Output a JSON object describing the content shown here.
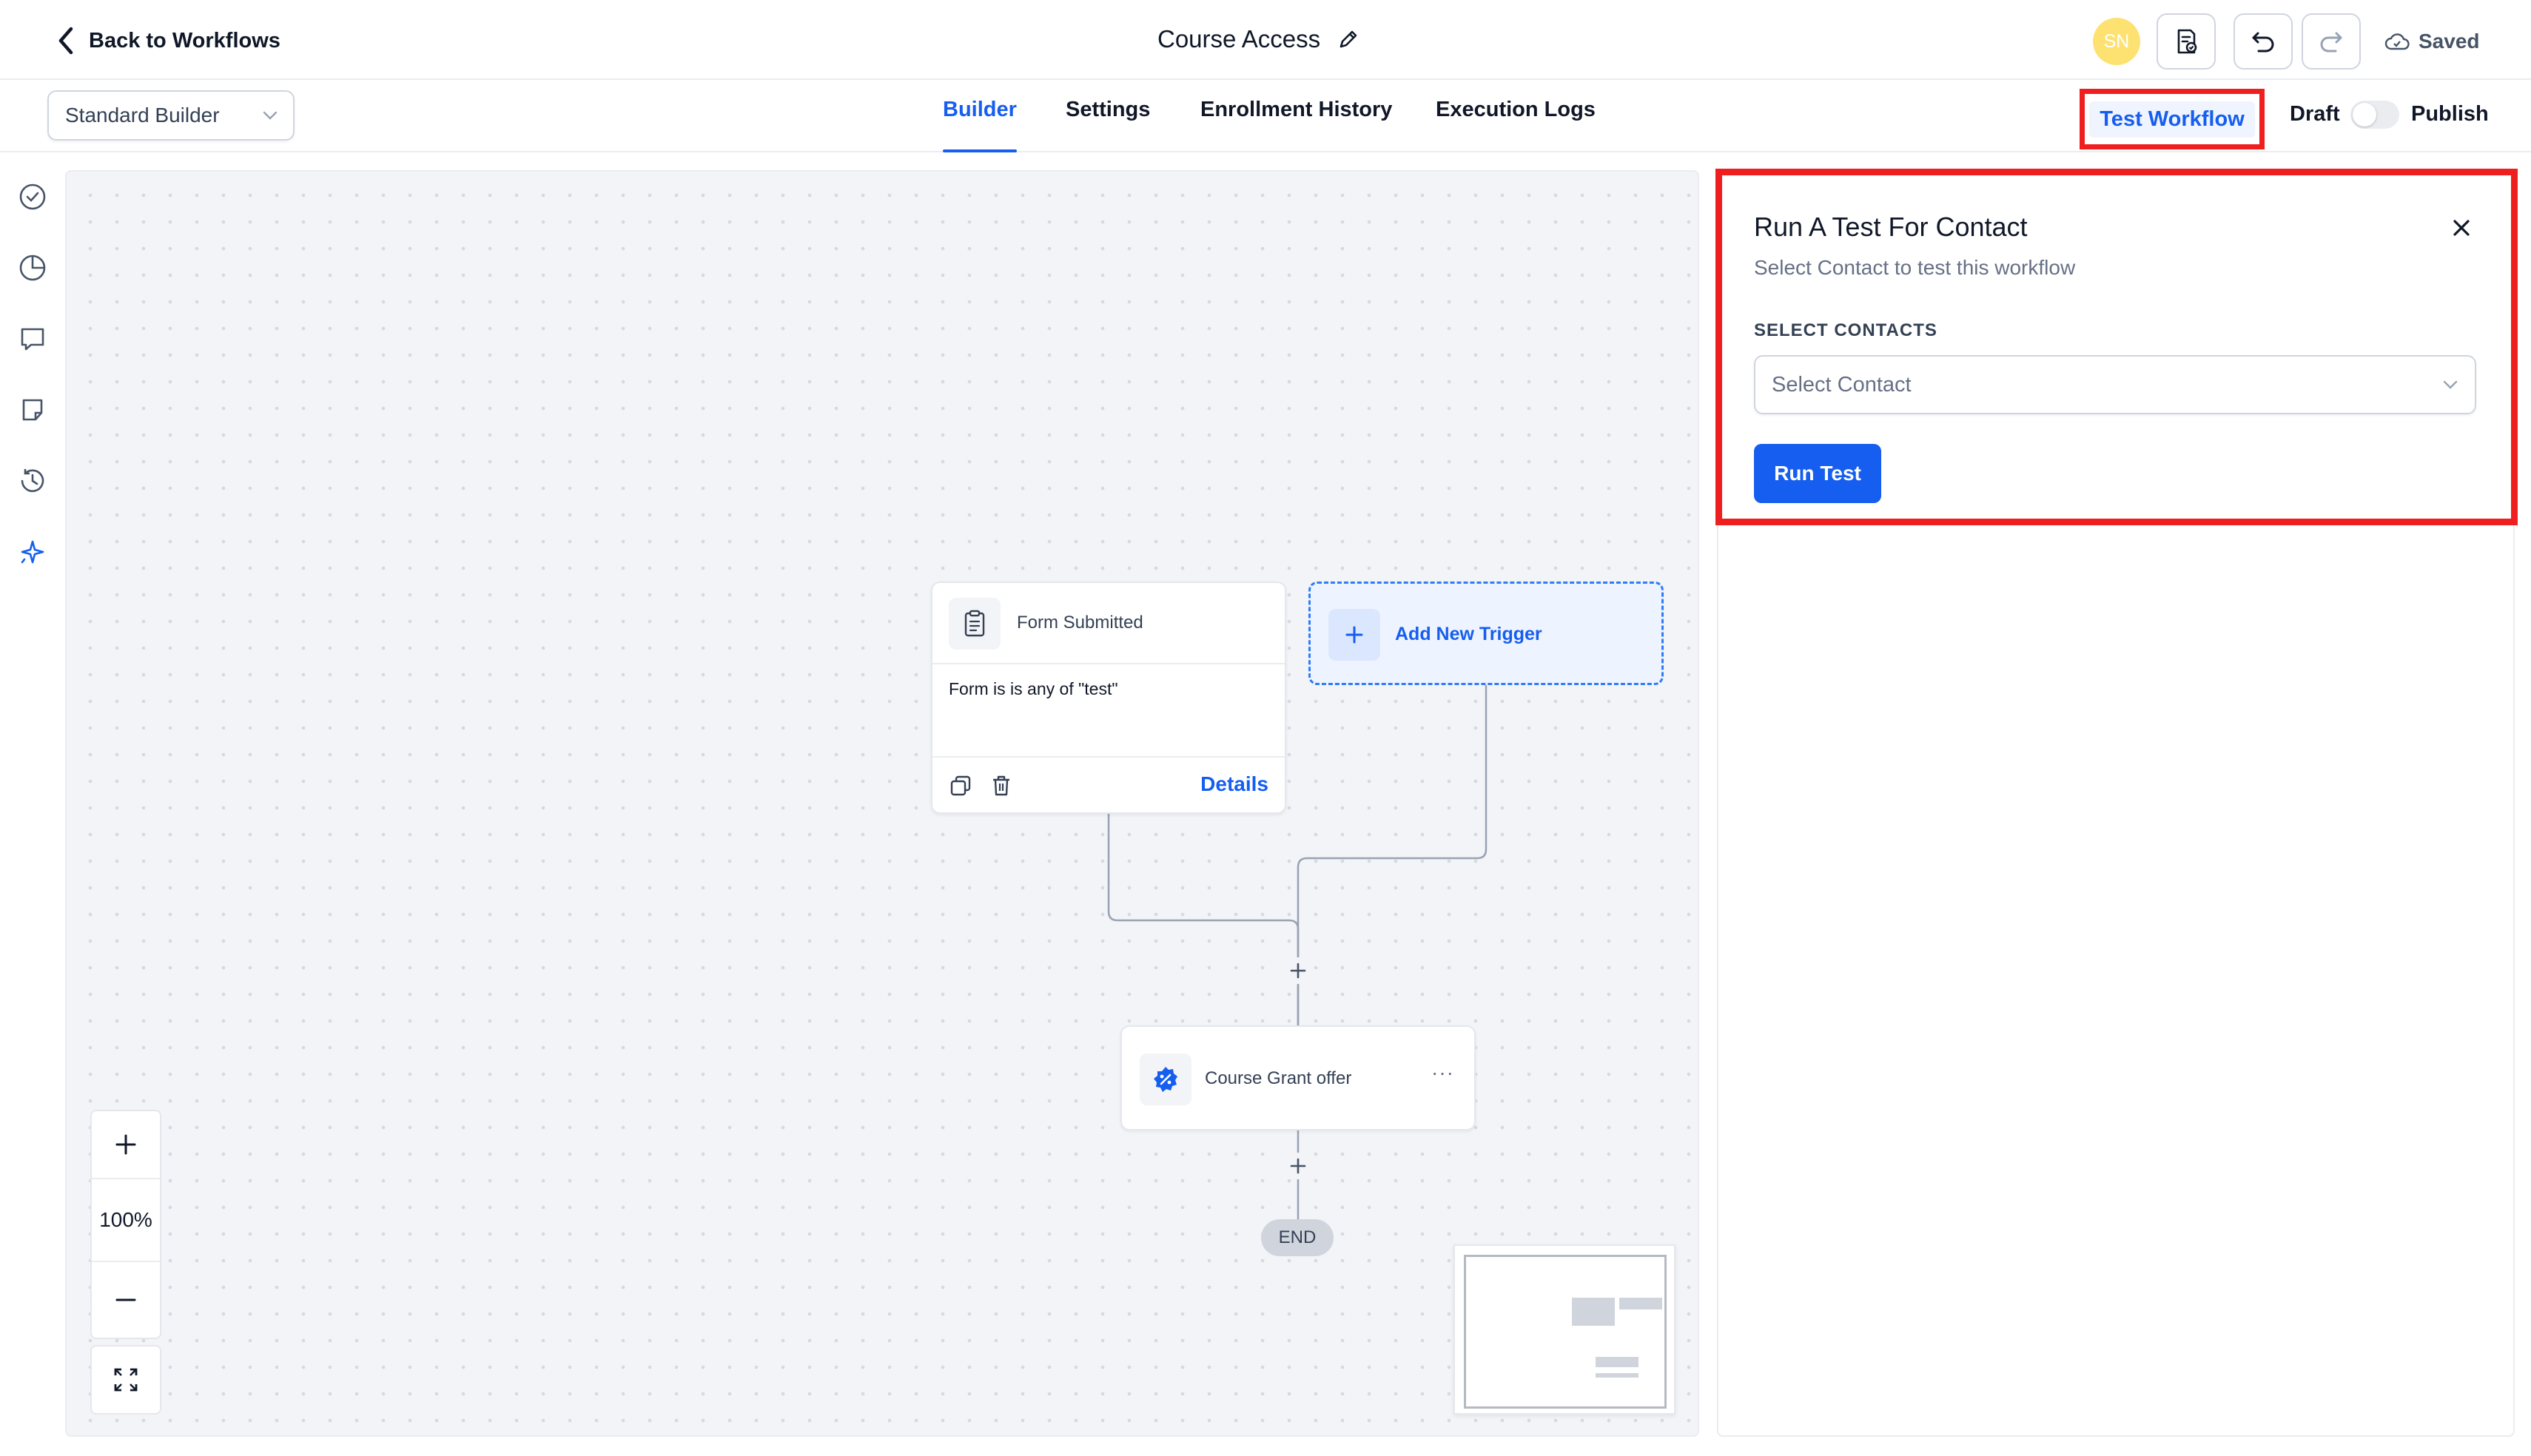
{
  "header": {
    "back_label": "Back to Workflows",
    "title": "Course Access",
    "avatar_initials": "SN",
    "saved_label": "Saved"
  },
  "subbar": {
    "builder_select": "Standard Builder",
    "tabs": [
      {
        "label": "Builder",
        "active": true
      },
      {
        "label": "Settings",
        "active": false
      },
      {
        "label": "Enrollment History",
        "active": false
      },
      {
        "label": "Execution Logs",
        "active": false
      }
    ],
    "test_workflow_label": "Test Workflow",
    "draft_label": "Draft",
    "publish_label": "Publish",
    "publish_enabled": false
  },
  "rail": {
    "icons": [
      "check-circle-icon",
      "pie-chart-icon",
      "comment-icon",
      "note-icon",
      "history-icon",
      "sparkle-icon"
    ]
  },
  "canvas": {
    "trigger": {
      "name": "Form Submitted",
      "condition": "Form is is any of \"test\"",
      "details_label": "Details"
    },
    "add_trigger_label": "Add New Trigger",
    "action": {
      "name": "Course Grant offer",
      "more_label": "···"
    },
    "end_label": "END",
    "zoom_level": "100%"
  },
  "panel": {
    "title": "Run A Test For Contact",
    "subtitle": "Select Contact to test this workflow",
    "contacts_label": "SELECT CONTACTS",
    "select_placeholder": "Select Contact",
    "run_label": "Run Test"
  },
  "colors": {
    "accent": "#155eef",
    "highlight": "#ef1f1f",
    "avatar": "#fde272",
    "canvas_bg": "#f2f4f7"
  }
}
